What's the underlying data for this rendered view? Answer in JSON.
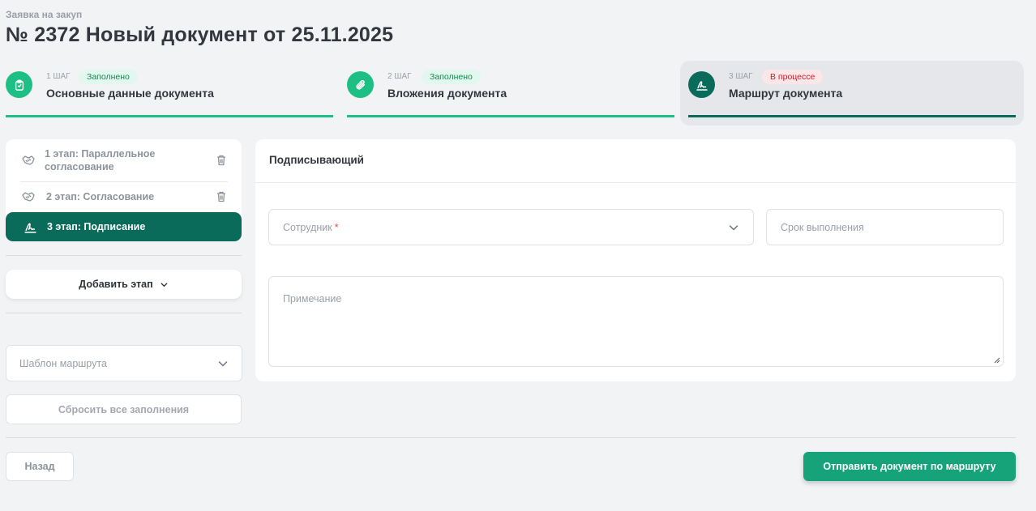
{
  "header": {
    "breadcrumb": "Заявка на закуп",
    "title": "№ 2372 Новый документ от 25.11.2025"
  },
  "steps": [
    {
      "num": "1 ШАГ",
      "status": "Заполнено",
      "name": "Основные данные документа",
      "icon": "clipboard-icon"
    },
    {
      "num": "2 ШАГ",
      "status": "Заполнено",
      "name": "Вложения документа",
      "icon": "paperclip-icon"
    },
    {
      "num": "3 ШАГ",
      "status": "В процессе",
      "name": "Маршрут документа",
      "icon": "signature-icon"
    }
  ],
  "stages": {
    "items": [
      {
        "label": "1 этап: Параллельное согласование",
        "icon": "handshake-icon"
      },
      {
        "label": "2 этап: Согласование",
        "icon": "handshake-icon"
      }
    ],
    "active": {
      "label": "3 этап: Подписание",
      "icon": "signature-icon"
    },
    "add_label": "Добавить этап",
    "template_placeholder": "Шаблон маршрута",
    "reset_label": "Сбросить все заполнения"
  },
  "signer": {
    "title": "Подписывающий",
    "employee_placeholder": "Сотрудник",
    "required_mark": "*",
    "deadline_placeholder": "Срок выполнения",
    "note_placeholder": "Примечание"
  },
  "footer": {
    "back_label": "Назад",
    "send_label": "Отправить документ по маршруту"
  },
  "colors": {
    "accent": "#1dbf84",
    "active": "#0b6b5b",
    "send_button": "#17a37a",
    "in_progress": "#c0242e"
  }
}
